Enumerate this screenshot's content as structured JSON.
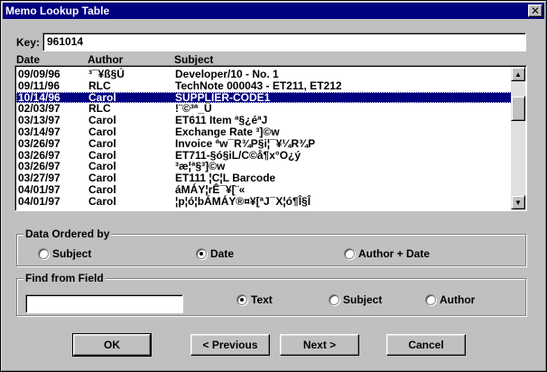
{
  "window": {
    "title": "Memo Lookup Table",
    "close_glyph": "✕"
  },
  "key": {
    "label": "Key:",
    "value": "961014"
  },
  "columns": {
    "date": "Date",
    "author": "Author",
    "subject": "Subject"
  },
  "rows": [
    {
      "date": "09/09/96",
      "author": "³¯¥ß§Ú",
      "subject": "Developer/10 - No. 1",
      "selected": false
    },
    {
      "date": "09/11/96",
      "author": "RLC",
      "subject": "TechNote 000043 - ET211, ET212",
      "selected": false
    },
    {
      "date": "10/14/96",
      "author": "Carol",
      "subject": "SUPPLIER-CODE1",
      "selected": true
    },
    {
      "date": "02/03/97",
      "author": "RLC",
      "subject": "!¨©³ª_Ü",
      "selected": false
    },
    {
      "date": "03/13/97",
      "author": "Carol",
      "subject": "ET611 Item ª§¿éªJ",
      "selected": false
    },
    {
      "date": "03/14/97",
      "author": "Carol",
      "subject": "Exchange Rate ³]©w",
      "selected": false
    },
    {
      "date": "03/26/97",
      "author": "Carol",
      "subject": "Invoice ªw¯R¾P§i¦¯¥¼R¾P",
      "selected": false
    },
    {
      "date": "03/26/97",
      "author": "Carol",
      "subject": "ET711-§ó§iL/C©å¶x°O¿ý",
      "selected": false
    },
    {
      "date": "03/26/97",
      "author": "Carol",
      "subject": "³æ¦ª§³]©w",
      "selected": false
    },
    {
      "date": "03/27/97",
      "author": "Carol",
      "subject": "ET111 ¦C¦L Barcode",
      "selected": false
    },
    {
      "date": "04/01/97",
      "author": "Carol",
      "subject": "áMÁY¦rÊ¯¥[¨«",
      "selected": false
    },
    {
      "date": "04/01/97",
      "author": "Carol",
      "subject": "¦p¦ó¦bÁMÁY®¤¥[ªJ¯X¦ó¶Î§Î",
      "selected": false
    }
  ],
  "scrollbar": {
    "up_glyph": "▲",
    "down_glyph": "▼"
  },
  "data_ordered_by": {
    "title": "Data Ordered by",
    "options": [
      "Subject",
      "Date",
      "Author + Date"
    ],
    "selected": "Date"
  },
  "find_from_field": {
    "title": "Find from Field",
    "input_value": "",
    "options": [
      "Text",
      "Subject",
      "Author"
    ],
    "selected": "Text"
  },
  "buttons": {
    "ok": "OK",
    "previous": "< Previous",
    "next": "Next >",
    "cancel": "Cancel"
  }
}
